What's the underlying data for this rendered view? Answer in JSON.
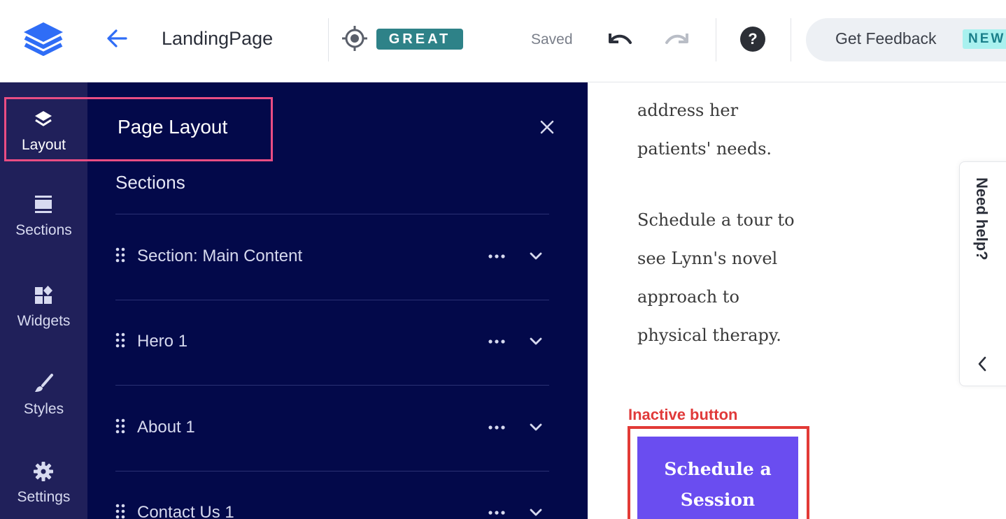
{
  "topbar": {
    "page_name": "LandingPage",
    "score_badge": "GREAT",
    "save_status": "Saved",
    "feedback_label": "Get Feedback",
    "feedback_badge": "NEW",
    "icons": [
      "layers-logo-icon",
      "back-arrow-icon",
      "target-icon",
      "undo-icon",
      "redo-icon",
      "help-icon"
    ]
  },
  "rail": {
    "items": [
      {
        "label": "Layout",
        "icon": "layers-icon",
        "active": true
      },
      {
        "label": "Sections",
        "icon": "sections-icon",
        "active": false
      },
      {
        "label": "Widgets",
        "icon": "widgets-icon",
        "active": false
      },
      {
        "label": "Styles",
        "icon": "brush-icon",
        "active": false
      },
      {
        "label": "Settings",
        "icon": "gear-icon",
        "active": false
      }
    ]
  },
  "panel": {
    "title": "Page Layout",
    "sections_heading": "Sections",
    "sections": [
      {
        "name": "Section: Main Content"
      },
      {
        "name": "Hero 1"
      },
      {
        "name": "About 1"
      },
      {
        "name": "Contact Us 1"
      }
    ]
  },
  "preview": {
    "lines": [
      "address her",
      "patients' needs.",
      "Schedule a tour to",
      "see Lynn's novel",
      "approach to",
      "physical therapy."
    ],
    "annotation_label": "Inactive button",
    "cta_line1": "Schedule a",
    "cta_line2": "Session"
  },
  "help_tab": {
    "label": "Need help?"
  },
  "colors": {
    "rail_bg": "#20205a",
    "panel_bg": "#03094a",
    "badge_great": "#2e8288",
    "badge_new_bg": "#a9f1ef",
    "cta_bg": "#6a4df0",
    "highlight_pink": "#e94d83",
    "highlight_red": "#e23a36",
    "logo_blue": "#2f6df6"
  }
}
